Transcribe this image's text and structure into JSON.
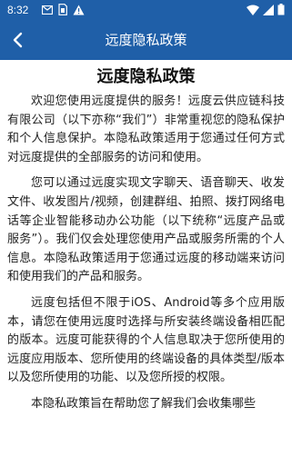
{
  "status_bar": {
    "time": "8:32",
    "left_icons": [
      "mail-icon",
      "sim-icon",
      "warning-icon"
    ],
    "right_icons": [
      "wifi-icon",
      "signal-icon",
      "battery-icon"
    ]
  },
  "app_bar": {
    "title": "远度隐私政策",
    "back_icon": "chevron-left-icon"
  },
  "document": {
    "title": "远度隐私政策",
    "paragraphs": [
      "欢迎您使用远度提供的服务！远度云供应链科技有限公司（以下亦称“我们”）非常重视您的隐私保护和个人信息保护。本隐私政策适用于您通过任何方式对远度提供的全部服务的访问和使用。",
      "您可以通过远度实现文字聊天、语音聊天、收发文件、收发图片/视频，创建群组、拍照、拨打网络电话等企业智能移动办公功能（以下统称“远度产品或服务”）。我们仅会处理您使用产品或服务所需的个人信息。本隐私政策适用于您通过远度的移动端来访问和使用我们的产品和服务。",
      "远度包括但不限于iOS、Android等多个应用版本，请您在使用远度时选择与所安装终端设备相匹配的版本。远度可能获得的个人信息取决于您所使用的远度应用版本、您所使用的终端设备的具体类型/版本以及您所使用的功能、以及您所授的权限。",
      "本隐私政策旨在帮助您了解我们会收集哪些"
    ]
  },
  "colors": {
    "primary": "#1f5fa8",
    "text": "#222222",
    "background": "#ffffff"
  }
}
